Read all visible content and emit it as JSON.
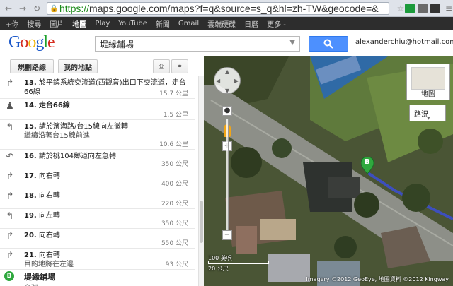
{
  "browser": {
    "url_https": "https://",
    "url_rest": "maps.google.com/maps?f=q&source=s_q&hl=zh-TW&geocode=&",
    "back_icon": "arrow-left-icon",
    "forward_icon": "arrow-right-icon",
    "reload_icon": "reload-icon"
  },
  "gbar": {
    "items": [
      "+你",
      "搜尋",
      "圖片",
      "地圖",
      "Play",
      "YouTube",
      "新聞",
      "Gmail",
      "雲端硬碟",
      "日曆",
      "更多 -"
    ],
    "active_index": 3
  },
  "header": {
    "logo": "Google",
    "search_value": "堤緣鋪場",
    "user_email": "alexanderchiu@hotmail.com"
  },
  "toolbar": {
    "directions_label": "規劃路線",
    "my_places_label": "我的地點"
  },
  "steps": [
    {
      "num": "13.",
      "text": "於平鎮系統交流道(西觀音)出口下交流道，走台66線",
      "dist": "15.7 公里",
      "icon": "turn-right-icon"
    },
    {
      "num": "14.",
      "text": "走台66線",
      "dist": "1.5 公里",
      "icon": "walk-icon"
    },
    {
      "num": "15.",
      "text": "請於濱海路/台15線向左微轉",
      "sub": "繼續沿著台15線前進",
      "dist": "10.6 公里",
      "icon": "slight-left-icon"
    },
    {
      "num": "16.",
      "text": "請於桃104鄉道向左急轉",
      "dist": "350 公尺",
      "icon": "sharp-left-icon"
    },
    {
      "num": "17.",
      "text": "向右轉",
      "dist": "400 公尺",
      "icon": "turn-right-icon"
    },
    {
      "num": "18.",
      "text": "向右轉",
      "dist": "220 公尺",
      "icon": "turn-right-icon"
    },
    {
      "num": "19.",
      "text": "向左轉",
      "dist": "350 公尺",
      "icon": "turn-left-icon"
    },
    {
      "num": "20.",
      "text": "向右轉",
      "dist": "550 公尺",
      "icon": "turn-right-icon"
    },
    {
      "num": "21.",
      "text": "向右轉",
      "sub": "目的地將在左邊",
      "dist": "93 公尺",
      "icon": "turn-right-icon"
    }
  ],
  "destination": {
    "marker": "B",
    "name": "堤緣鋪場",
    "sub": "台灣"
  },
  "map": {
    "map_button_label": "地圖",
    "traffic_label": "路況",
    "scale_ft": "100 英呎",
    "scale_m": "20 公尺",
    "marker": "B",
    "copyright": "Imagery ©2012 GeoEye, 地圖資料 ©2012 Kingway"
  }
}
